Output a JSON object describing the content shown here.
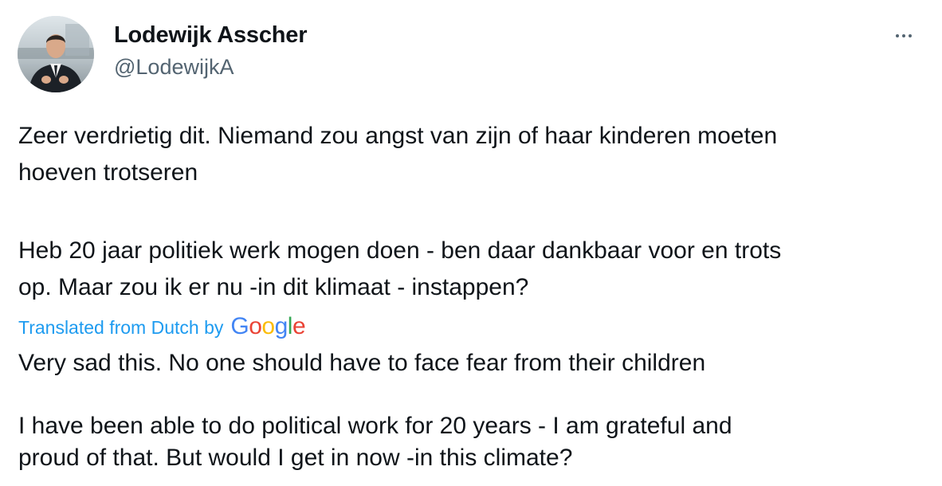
{
  "author": {
    "name": "Lodewijk Asscher",
    "handle": "@LodewijkA",
    "avatar_icon": "person-avatar"
  },
  "menu": {
    "more_icon": "more-horizontal-icon"
  },
  "tweet": {
    "original": [
      [
        "Zeer verdrietig dit. Niemand zou angst van zijn of haar kinderen moeten",
        "hoeven trotseren"
      ],
      [
        "Heb 20 jaar politiek werk mogen doen - ben daar dankbaar voor en trots",
        "op. Maar zou ik er nu -in dit klimaat - instappen?"
      ]
    ],
    "translation_notice": "Translated from Dutch by",
    "translation_provider": "Google",
    "translated": [
      [
        "Very sad this. No one should have to face fear from their children"
      ],
      [
        "I have been able to do political work for 20 years - I am grateful and",
        "proud of that. But would I get in now -in this climate?"
      ]
    ]
  },
  "colors": {
    "text": "#0f1419",
    "secondary": "#536471",
    "link": "#1d9bf0"
  }
}
